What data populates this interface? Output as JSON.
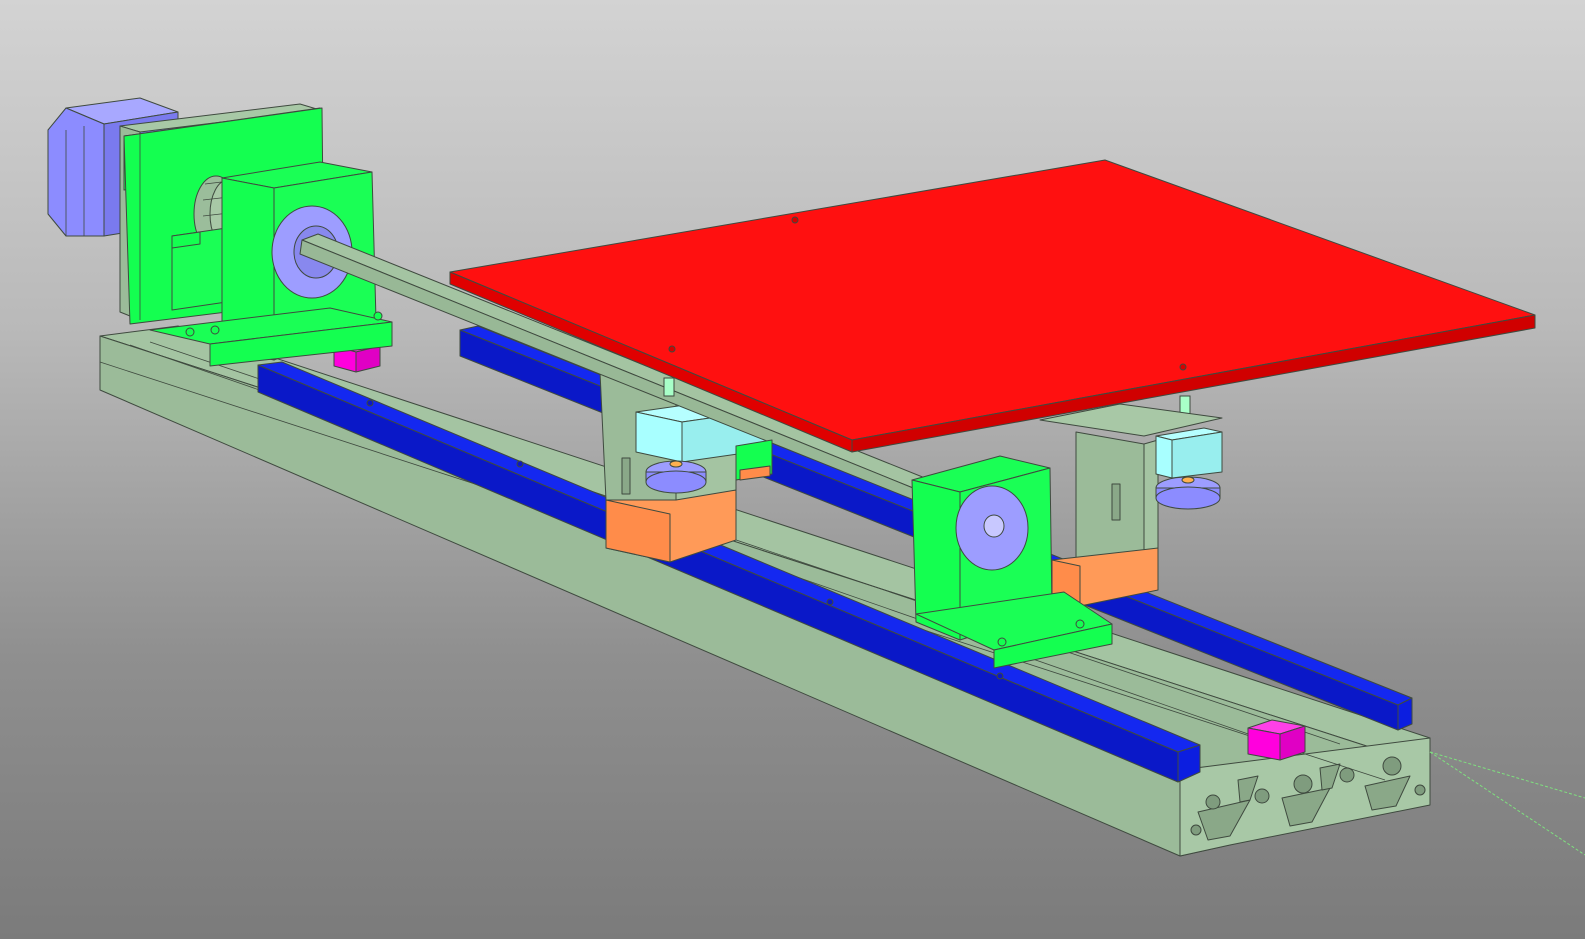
{
  "viewport": {
    "type": "3D CAD viewport",
    "background_gradient": [
      "#d3d3d3",
      "#7b7b7b"
    ],
    "colors": {
      "extrusion": "#9bbd9b",
      "rail": "#0c1ee6",
      "bed_plate": "#ff0a0a",
      "bracket": "#14ff50",
      "carriage_block": "#ff8c4a",
      "spacer_block": "#a8ffff",
      "motor": "#8c8cff",
      "end_stop": "#ff00dd",
      "lead_screw": "#9bbd9b",
      "knob": "#8c8cff"
    },
    "parts": [
      {
        "name": "aluminium-extrusion-base",
        "color": "extrusion"
      },
      {
        "name": "linear-rail-left",
        "color": "rail"
      },
      {
        "name": "linear-rail-right",
        "color": "rail"
      },
      {
        "name": "stepper-motor",
        "color": "motor"
      },
      {
        "name": "motor-mount-bracket",
        "color": "bracket"
      },
      {
        "name": "bearing-block-front",
        "color": "bracket"
      },
      {
        "name": "bearing-block-rear",
        "color": "bracket"
      },
      {
        "name": "lead-screw",
        "color": "lead_screw"
      },
      {
        "name": "print-bed-plate",
        "color": "bed_plate"
      },
      {
        "name": "carriage-left",
        "color": "carriage_block"
      },
      {
        "name": "carriage-right",
        "color": "carriage_block"
      },
      {
        "name": "leveling-knob-left",
        "color": "knob"
      },
      {
        "name": "leveling-knob-right",
        "color": "knob"
      },
      {
        "name": "end-stop-rear",
        "color": "end_stop"
      },
      {
        "name": "end-stop-front",
        "color": "end_stop"
      }
    ]
  }
}
